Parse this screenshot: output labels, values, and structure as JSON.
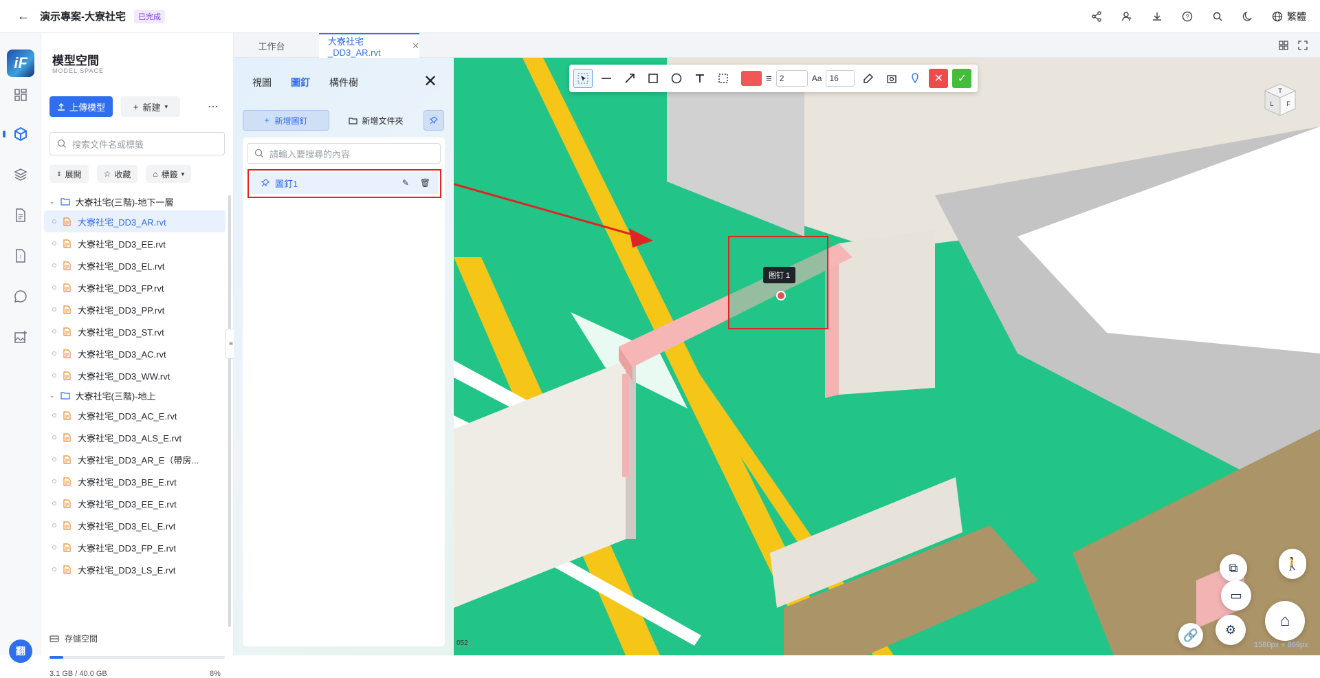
{
  "header": {
    "project_title": "演示專案-大寮社宅",
    "status": "已完成",
    "language": "繁體",
    "icons": [
      "share-icon",
      "users-icon",
      "download-icon",
      "help-icon",
      "search-icon",
      "moon-icon",
      "globe-icon"
    ]
  },
  "rail": {
    "logo": "iF",
    "items": [
      "dashboard-icon",
      "model-icon",
      "layers-icon",
      "document-icon",
      "report-icon",
      "chat-icon",
      "image-add-icon"
    ],
    "avatar": "翻"
  },
  "file_panel": {
    "title": "模型空間",
    "subtitle": "MODEL SPACE",
    "upload_label": "上傳模型",
    "new_label": "新建",
    "search_placeholder": "搜索文件名或標籤",
    "filters": [
      "展開",
      "收藏",
      "標籤"
    ],
    "folders": [
      {
        "name": "大寮社宅(三階)-地下一層",
        "files": [
          "大寮社宅_DD3_AR.rvt",
          "大寮社宅_DD3_EE.rvt",
          "大寮社宅_DD3_EL.rvt",
          "大寮社宅_DD3_FP.rvt",
          "大寮社宅_DD3_PP.rvt",
          "大寮社宅_DD3_ST.rvt",
          "大寮社宅_DD3_AC.rvt",
          "大寮社宅_DD3_WW.rvt"
        ]
      },
      {
        "name": "大寮社宅(三階)-地上",
        "files": [
          "大寮社宅_DD3_AC_E.rvt",
          "大寮社宅_DD3_ALS_E.rvt",
          "大寮社宅_DD3_AR_E（帶房...",
          "大寮社宅_DD3_BE_E.rvt",
          "大寮社宅_DD3_EE_E.rvt",
          "大寮社宅_DD3_EL_E.rvt",
          "大寮社宅_DD3_FP_E.rvt",
          "大寮社宅_DD3_LS_E.rvt"
        ]
      }
    ],
    "selected_file": "大寮社宅_DD3_AR.rvt",
    "storage": {
      "label": "存儲空間",
      "used": "3.1 GB / 40.0 GB",
      "percent_text": "8%",
      "fraction": 0.08
    }
  },
  "tabs": [
    {
      "label": "工作台",
      "active": false
    },
    {
      "label": "大寮社宅_DD3_AR.rvt",
      "active": true
    }
  ],
  "pin_panel": {
    "tabs": [
      "視圖",
      "圖釘",
      "構件樹"
    ],
    "active_tab": "圖釘",
    "new_pin_label": "新增圖釘",
    "new_folder_label": "新增文件夾",
    "search_placeholder": "請輸入要搜尋的內容",
    "pins": [
      {
        "name": "圖釘1"
      }
    ]
  },
  "toolbar": {
    "tools": [
      "select-icon",
      "line-icon",
      "arrow-icon",
      "rectangle-icon",
      "circle-icon",
      "text-icon",
      "marquee-icon"
    ],
    "color": "#f25757",
    "line_width": "2",
    "font_label": "Aa",
    "font_size": "16",
    "extra_tools": [
      "eraser-icon",
      "screenshot-icon",
      "pin-marker-icon"
    ]
  },
  "viewport": {
    "pin_label": "图钉 1",
    "cube_faces": [
      "T",
      "L",
      "F"
    ],
    "size_readout": "1580px × 869px",
    "coord_readout": "052"
  },
  "colors": {
    "accent": "#2f6fed",
    "floor_green": "#22c587",
    "highlight_pink": "#f7b6b6",
    "annotation_red": "#e02323"
  }
}
